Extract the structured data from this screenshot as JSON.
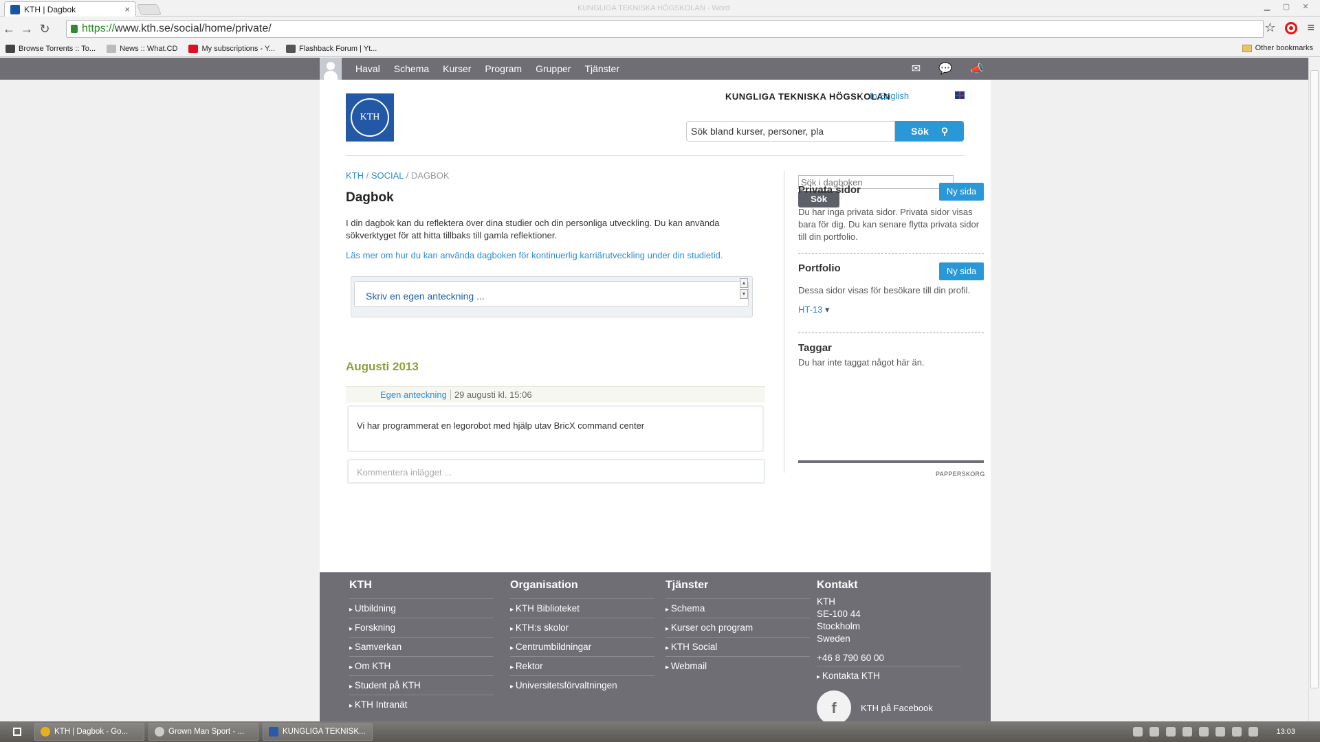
{
  "browser": {
    "tab_title": "KTH | Dagbok",
    "tab_close": "×",
    "window_title": "KUNGLIGA TEKNISKA HÖGSKOLAN - Word",
    "url_scheme": "https://",
    "url_rest": "www.kth.se/social/home/private/",
    "back": "←",
    "forward": "→",
    "reload": "↻",
    "star": "☆",
    "menu": "≡",
    "bookmarks": [
      {
        "label": "Browse Torrents :: To...",
        "color": "#444"
      },
      {
        "label": "News :: What.CD",
        "color": "#bbb"
      },
      {
        "label": "My subscriptions - Y...",
        "color": "#d12"
      },
      {
        "label": "Flashback Forum | Yt...",
        "color": "#555"
      }
    ],
    "other_bookmarks": "Other bookmarks"
  },
  "topnav": {
    "links": [
      "Haval",
      "Schema",
      "Kurser",
      "Program",
      "Grupper",
      "Tjänster"
    ],
    "mail_icon": "✉",
    "chat_icon": "💬",
    "megaphone_icon": "📣"
  },
  "header": {
    "logo_text": "KTH",
    "university": "KUNGLIGA TEKNISKA HÖGSKOLAN",
    "in_english": "In English",
    "search_placeholder": "Sök bland kurser, personer, pla",
    "search_button": "Sök",
    "search_icon": "⚲"
  },
  "breadcrumb": {
    "kth": "KTH",
    "sep1": " / ",
    "social": "SOCIAL",
    "sep2": " / ",
    "current": "DAGBOK"
  },
  "main": {
    "title": "Dagbok",
    "intro": "I din dagbok kan du reflektera över dina studier och din personliga utveckling. Du kan använda sökverktyget för att hitta tillbaks till gamla reflektioner.",
    "read_more": "Läs mer om hur du kan använda dagboken för kontinuerlig karriärutveckling under din studietid.",
    "editor_placeholder": "Skriv en egen anteckning ...",
    "scroll_up": "▴",
    "scroll_down": "▾",
    "month": "Augusti 2013",
    "entry": {
      "type": "Egen anteckning",
      "date": "29 augusti kl. 15:06",
      "text": "Vi har programmerat en legorobot med hjälp utav BricX command center"
    },
    "comment_placeholder": "Kommentera inlägget ..."
  },
  "sidebar": {
    "search_placeholder": "Sök i dagboken",
    "search_button": "Sök",
    "private": {
      "title": "Privata sidor",
      "button": "Ny sida",
      "text": "Du har inga privata sidor. Privata sidor visas bara för dig. Du kan senare flytta privata sidor till din portfolio."
    },
    "portfolio": {
      "title": "Portfolio",
      "button": "Ny sida",
      "text": "Dessa sidor visas för besökare till din profil.",
      "term": "HT-13",
      "term_caret": "▾"
    },
    "tags": {
      "title": "Taggar",
      "text": "Du har inte taggat något här än."
    },
    "trash": "PAPPERSKORG"
  },
  "footer": {
    "kth": {
      "title": "KTH",
      "links": [
        "Utbildning",
        "Forskning",
        "Samverkan",
        "Om KTH",
        "Student på KTH",
        "KTH Intranät"
      ]
    },
    "organisation": {
      "title": "Organisation",
      "links": [
        "KTH Biblioteket",
        "KTH:s skolor",
        "Centrumbildningar",
        "Rektor",
        "Universitetsförvaltningen"
      ]
    },
    "tjanster": {
      "title": "Tjänster",
      "links": [
        "Schema",
        "Kurser och program",
        "KTH Social",
        "Webmail"
      ]
    },
    "kontakt": {
      "title": "Kontakt",
      "address": [
        "KTH",
        "SE-100 44",
        "Stockholm",
        "Sweden"
      ],
      "phone": "+46 8 790 60 00",
      "contact_link": "Kontakta KTH",
      "facebook": "KTH på Facebook",
      "facebook_icon": "f"
    }
  },
  "taskbar": {
    "tasks": [
      {
        "label": "KTH | Dagbok - Go...",
        "color": "#e8b020"
      },
      {
        "label": "Grown Man Sport - ...",
        "color": "#ccc"
      },
      {
        "label": "KUNGLIGA TEKNISK...",
        "color": "#2b5ba8"
      }
    ],
    "clock": "13:03"
  }
}
